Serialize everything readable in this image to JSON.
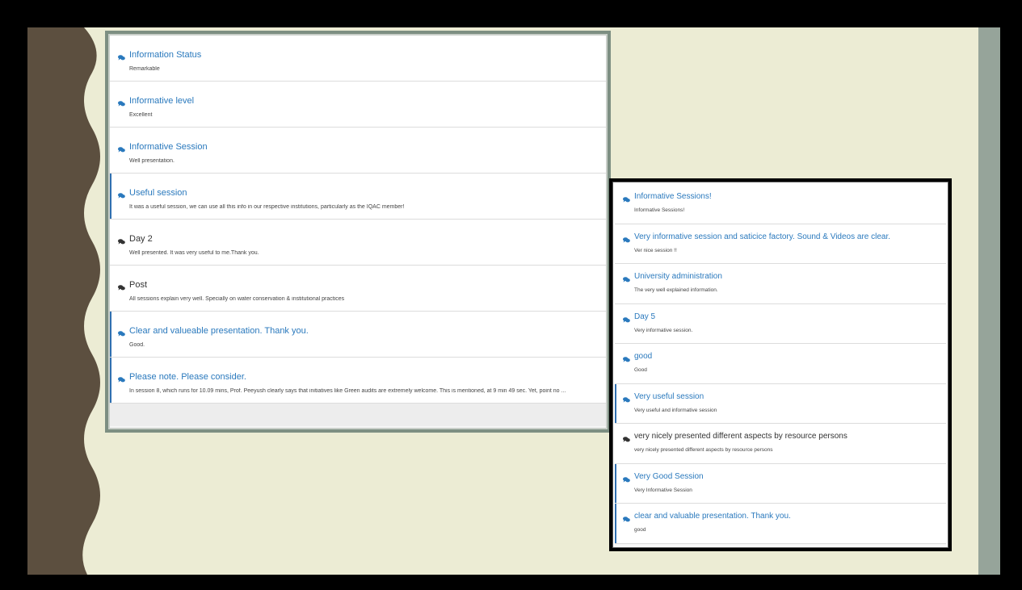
{
  "colors": {
    "outer_frame": "#000000",
    "slide_background": "#ececd4",
    "decorative_wave": "#5c4f3f",
    "right_band": "#96a49a",
    "left_panel_border": "#7d8f82",
    "link_blue": "#2a79bd"
  },
  "left_panel": {
    "items": [
      {
        "title": "Information Status",
        "text": "Remarkable",
        "icon": "comments-icon",
        "marked": false,
        "dark": false
      },
      {
        "title": "Informative level",
        "text": "Excellent",
        "icon": "comments-icon",
        "marked": false,
        "dark": false
      },
      {
        "title": "Informative Session",
        "text": "Well presentation.",
        "icon": "comments-icon",
        "marked": false,
        "dark": false
      },
      {
        "title": "Useful session",
        "text": "It was a useful session, we can use all this info in our respective institutions, particularly as the IQAC member!",
        "icon": "comments-icon",
        "marked": true,
        "dark": false
      },
      {
        "title": "Day 2",
        "text": "Well presented. It was very useful to me.Thank you.",
        "icon": "comments-icon",
        "marked": false,
        "dark": true
      },
      {
        "title": "Post",
        "text": "All sessions explain very well. Specially on water conservation & institutional practices",
        "icon": "comments-icon",
        "marked": false,
        "dark": true
      },
      {
        "title": "Clear and valueable presentation. Thank you.",
        "text": "Good.",
        "icon": "comments-icon",
        "marked": true,
        "dark": false
      },
      {
        "title": "Please note. Please consider.",
        "text": "In session 8, which runs for 10.09 mins, Prof. Peeyush clearly says that initiatives like Green audits are extremely welcome. This is mentioned, at 9 min 49 sec. Yet, point no ...",
        "icon": "comments-icon",
        "marked": true,
        "dark": false
      }
    ]
  },
  "right_panel": {
    "items": [
      {
        "title": "Informative Sessions!",
        "text": "Informative Sessions!",
        "icon": "comments-icon",
        "marked": false,
        "dark": false
      },
      {
        "title": "Very informative session and saticice factory. Sound & Videos are clear.",
        "text": "Ver nice session !!",
        "icon": "comments-icon",
        "marked": false,
        "dark": false
      },
      {
        "title": "University administration",
        "text": "The very well explained information.",
        "icon": "comments-icon",
        "marked": false,
        "dark": false
      },
      {
        "title": "Day 5",
        "text": "Very informative session.",
        "icon": "comments-icon",
        "marked": false,
        "dark": false
      },
      {
        "title": "good",
        "text": "Good",
        "icon": "comments-icon",
        "marked": false,
        "dark": false
      },
      {
        "title": "Very useful session",
        "text": "Very useful and informative session",
        "icon": "comments-icon",
        "marked": true,
        "dark": false
      },
      {
        "title": "very nicely presented different aspects by resource persons",
        "text": "very nicely presented different aspects by resource persons",
        "icon": "comments-icon",
        "marked": false,
        "dark": true
      },
      {
        "title": "Very Good Session",
        "text": "Very Informative Session",
        "icon": "comments-icon",
        "marked": true,
        "dark": false
      },
      {
        "title": "clear and valuable presentation. Thank you.",
        "text": "good",
        "icon": "comments-icon",
        "marked": true,
        "dark": false
      }
    ]
  }
}
